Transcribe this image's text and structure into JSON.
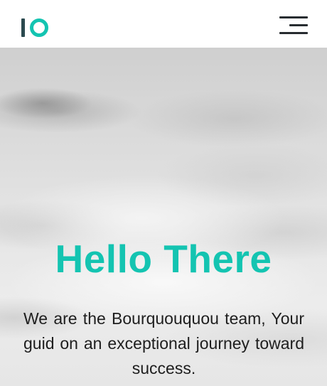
{
  "header": {
    "logo": {
      "name": "IO",
      "bar_color": "#2b4a4f",
      "ring_color": "#14c4b1"
    },
    "menu_icon": "hamburger-menu-icon"
  },
  "hero": {
    "title": "Hello There",
    "title_color": "#14c4b1",
    "description": "We are the Bourquouquou team, Your guid on an exceptional journey toward success.",
    "background": "cloudy-sky-grayscale-image"
  }
}
